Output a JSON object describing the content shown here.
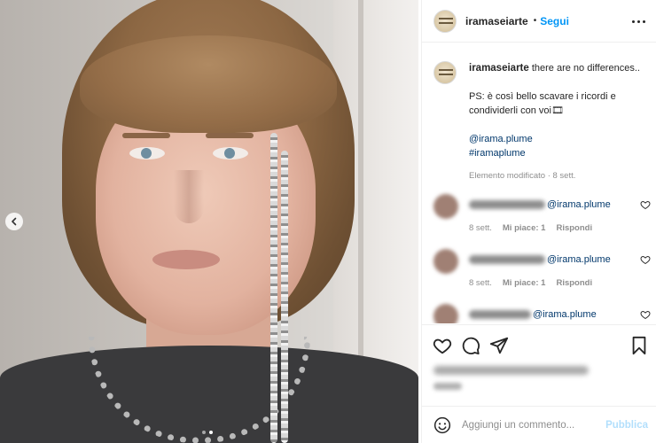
{
  "header": {
    "username": "iramaseiarte",
    "separator": "•",
    "follow_label": "Segui"
  },
  "caption": {
    "username": "iramaseiarte",
    "text": "there are no differences..",
    "line2": "PS: è così bello scavare i ricordi e condividerli con voi🎞",
    "mention": "@irama.plume",
    "hashtag": "#iramaplume",
    "meta": "Elemento modificato · 8 sett."
  },
  "comments": [
    {
      "mention": "@irama.plume",
      "time": "8 sett.",
      "likes": "Mi piace: 1",
      "reply": "Rispondi"
    },
    {
      "mention": "@irama.plume",
      "time": "8 sett.",
      "likes": "Mi piace: 1",
      "reply": "Rispondi"
    },
    {
      "mention": "@irama.plume"
    }
  ],
  "comment_box": {
    "placeholder": "Aggiungi un commento...",
    "post_label": "Pubblica"
  },
  "carousel": {
    "count": 2,
    "active": 2
  },
  "colors": {
    "accent": "#0095f6",
    "link": "#00376b",
    "muted": "#8e8e8e",
    "post_disabled": "#b2dffc"
  }
}
